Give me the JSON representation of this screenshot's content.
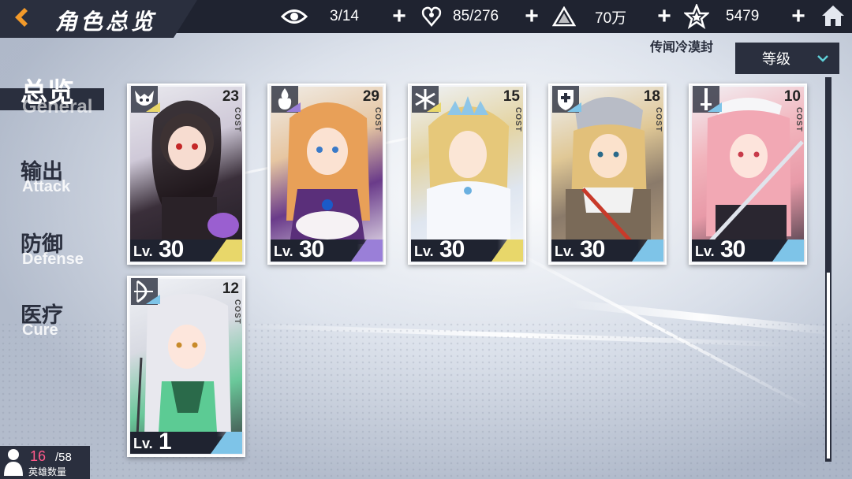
{
  "header": {
    "title": "角色总览",
    "stats": [
      {
        "name": "view",
        "icon": "eye-icon",
        "value": "3/14"
      },
      {
        "name": "stamina",
        "icon": "heart-hand-icon",
        "value": "85/276"
      },
      {
        "name": "gold",
        "icon": "triangle-coin-icon",
        "value": "70万"
      },
      {
        "name": "star",
        "icon": "star-gem-icon",
        "value": "5479"
      }
    ],
    "plus_label": "+"
  },
  "region_label": "传闻冷漠封",
  "sort": {
    "selected": "等级"
  },
  "sidebar": {
    "items": [
      {
        "zh": "总览",
        "en": "General",
        "active": true
      },
      {
        "zh": "输出",
        "en": "Attack",
        "active": false
      },
      {
        "zh": "防御",
        "en": "Defense",
        "active": false
      },
      {
        "zh": "医疗",
        "en": "Cure",
        "active": false
      }
    ]
  },
  "cards": [
    {
      "cost": "23",
      "cost_label": "COST",
      "level_prefix": "Lv.",
      "level": "30",
      "class_icon": "demon-mask-icon",
      "rarity_color": "#e8d76a"
    },
    {
      "cost": "29",
      "cost_label": "COST",
      "level_prefix": "Lv.",
      "level": "30",
      "class_icon": "flame-crest-icon",
      "rarity_color": "#9a7fd8"
    },
    {
      "cost": "15",
      "cost_label": "COST",
      "level_prefix": "Lv.",
      "level": "30",
      "class_icon": "snowflake-icon",
      "rarity_color": "#e8d76a"
    },
    {
      "cost": "18",
      "cost_label": "COST",
      "level_prefix": "Lv.",
      "level": "30",
      "class_icon": "shield-cross-icon",
      "rarity_color": "#7ec4e8"
    },
    {
      "cost": "10",
      "cost_label": "COST",
      "level_prefix": "Lv.",
      "level": "30",
      "class_icon": "sword-icon",
      "rarity_color": "#7ec4e8"
    },
    {
      "cost": "12",
      "cost_label": "COST",
      "level_prefix": "Lv.",
      "level": "1",
      "class_icon": "bow-icon",
      "rarity_color": "#7ec4e8"
    }
  ],
  "hero_count": {
    "current": "16",
    "max": "/58",
    "label": "英雄数量"
  }
}
